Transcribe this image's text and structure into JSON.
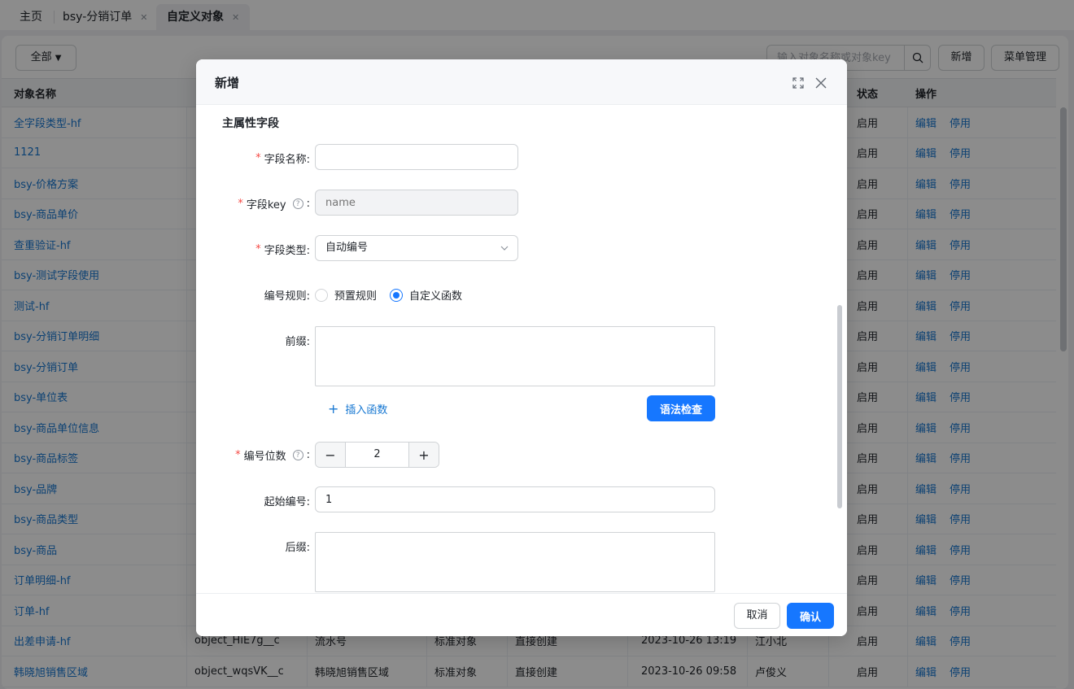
{
  "tabs": [
    {
      "label": "主页"
    },
    {
      "label": "bsy-分销订单",
      "closable": true
    },
    {
      "label": "自定义对象",
      "closable": true,
      "active": true
    }
  ],
  "toolbar": {
    "filter_label": "全部",
    "search_placeholder": "输入对象名称或对象key",
    "add_label": "新增",
    "menu_label": "菜单管理"
  },
  "table": {
    "headers": {
      "name": "对象名称",
      "status": "状态",
      "ops": "操作"
    },
    "rows": [
      {
        "name": "全字段类型-hf",
        "status": "启用"
      },
      {
        "name": "1121",
        "status": "启用"
      },
      {
        "name": "bsy-价格方案",
        "status": "启用"
      },
      {
        "name": "bsy-商品单价",
        "status": "启用"
      },
      {
        "name": "查重验证-hf",
        "status": "启用"
      },
      {
        "name": "bsy-测试字段使用",
        "status": "启用"
      },
      {
        "name": "测试-hf",
        "status": "启用"
      },
      {
        "name": "bsy-分销订单明细",
        "status": "启用"
      },
      {
        "name": "bsy-分销订单",
        "status": "启用"
      },
      {
        "name": "bsy-单位表",
        "status": "启用"
      },
      {
        "name": "bsy-商品单位信息",
        "status": "启用"
      },
      {
        "name": "bsy-商品标签",
        "status": "启用"
      },
      {
        "name": "bsy-品牌",
        "status": "启用"
      },
      {
        "name": "bsy-商品类型",
        "status": "启用"
      },
      {
        "name": "bsy-商品",
        "status": "启用"
      },
      {
        "name": "订单明细-hf",
        "status": "启用"
      },
      {
        "name": "订单-hf",
        "status": "启用"
      },
      {
        "name": "出差申请-hf",
        "key": "object_HiE7g__c",
        "field": "流水号",
        "type": "标准对象",
        "method": "直接创建",
        "time": "2023-10-26 13:19",
        "user": "江小北",
        "status": "启用"
      },
      {
        "name": "韩晓旭销售区域",
        "key": "object_wqsVK__c",
        "field": "韩晓旭销售区域",
        "type": "标准对象",
        "method": "直接创建",
        "time": "2023-10-26 09:58",
        "user": "卢俊义",
        "status": "启用"
      }
    ],
    "edit_label": "编辑",
    "disable_label": "停用"
  },
  "modal": {
    "title": "新增",
    "section_title": "主属性字段",
    "field_name_label": "字段名称:",
    "field_name_value": "",
    "field_key_label": "字段key",
    "field_key_placeholder": "name",
    "field_type_label": "字段类型:",
    "field_type_value": "自动编号",
    "numbering_rule_label": "编号规则:",
    "rule_options": [
      "预置规则",
      "自定义函数"
    ],
    "rule_selected": "自定义函数",
    "prefix_label": "前缀:",
    "insert_function_label": "插入函数",
    "syntax_check_label": "语法检查",
    "digits_label": "编号位数",
    "digits_value": "2",
    "start_number_label": "起始编号:",
    "start_number_value": "1",
    "suffix_label": "后缀:",
    "cancel_label": "取消",
    "confirm_label": "确认"
  },
  "colors": {
    "accent": "#1677ff",
    "link": "#1677d2",
    "required": "#f54a45"
  }
}
